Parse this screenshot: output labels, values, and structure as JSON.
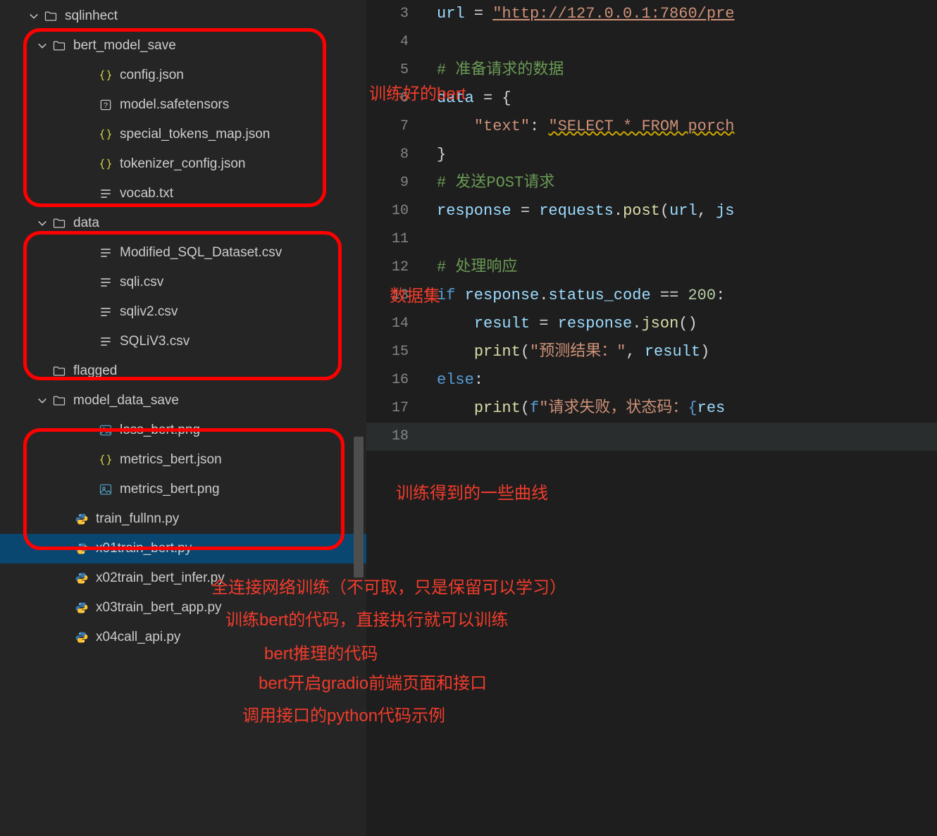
{
  "tree": {
    "root": "sqlinhect",
    "bert_model_save": {
      "name": "bert_model_save",
      "files": [
        "config.json",
        "model.safetensors",
        "special_tokens_map.json",
        "tokenizer_config.json",
        "vocab.txt"
      ]
    },
    "data": {
      "name": "data",
      "files": [
        "Modified_SQL_Dataset.csv",
        "sqli.csv",
        "sqliv2.csv",
        "SQLiV3.csv"
      ]
    },
    "flagged": "flagged",
    "model_data_save": {
      "name": "model_data_save",
      "files": [
        "loss_bert.png",
        "metrics_bert.json",
        "metrics_bert.png"
      ]
    },
    "root_files": [
      "train_fullnn.py",
      "x01train_bert.py",
      "x02train_bert_infer.py",
      "x03train_bert_app.py",
      "x04call_api.py"
    ]
  },
  "annotations": {
    "a1": "训练好的bert",
    "a2": "数据集",
    "a3": "训练得到的一些曲线",
    "a4": "全连接网络训练（不可取，只是保留可以学习）",
    "a5": "训练bert的代码，直接执行就可以训练",
    "a6": "bert推理的代码",
    "a7": "bert开启gradio前端页面和接口",
    "a8": "调用接口的python代码示例"
  },
  "code": {
    "line3_url": "url",
    "line3_eq": " = ",
    "line3_str": "\"http://127.0.0.1:7860/pre",
    "line5_cmt": "# 准备请求的数据",
    "line6": "data = {",
    "line6_data": "data",
    "line6_rest": " = {",
    "line7_key": "\"text\"",
    "line7_colon": ": ",
    "line7_val": "\"SELECT * FROM porch",
    "line8": "}",
    "line9_cmt": "# 发送POST请求",
    "line10_resp": "response",
    "line10_eq": " = ",
    "line10_req": "requests",
    "line10_dot": ".",
    "line10_post": "post",
    "line10_open": "(",
    "line10_url": "url",
    "line10_comma": ", ",
    "line10_js": "js",
    "line12_cmt": "# 处理响应",
    "line13_if": "if",
    "line13_cond": " response.status_code == ",
    "line13_resp": " response",
    "line13_sc": "status_code",
    "line13_eqeq": " == ",
    "line13_200": "200",
    "line13_colon": ":",
    "line14_res": "result",
    "line14_eq": " = ",
    "line14_r": "response",
    "line14_dot": ".",
    "line14_json": "json",
    "line14_paren": "()",
    "line15_print": "print",
    "line15_open": "(",
    "line15_str": "\"预测结果：\"",
    "line15_comma": ", ",
    "line15_result": "result",
    "line15_close": ")",
    "line16_else": "else",
    "line16_colon": ":",
    "line17_print": "print",
    "line17_open": "(",
    "line17_f": "f",
    "line17_str": "\"请求失败，状态码：",
    "line17_br": "{",
    "line17_res": "res"
  },
  "gutter": [
    "3",
    "4",
    "5",
    "6",
    "7",
    "8",
    "9",
    "10",
    "11",
    "12",
    "13",
    "14",
    "15",
    "16",
    "17",
    "18"
  ]
}
